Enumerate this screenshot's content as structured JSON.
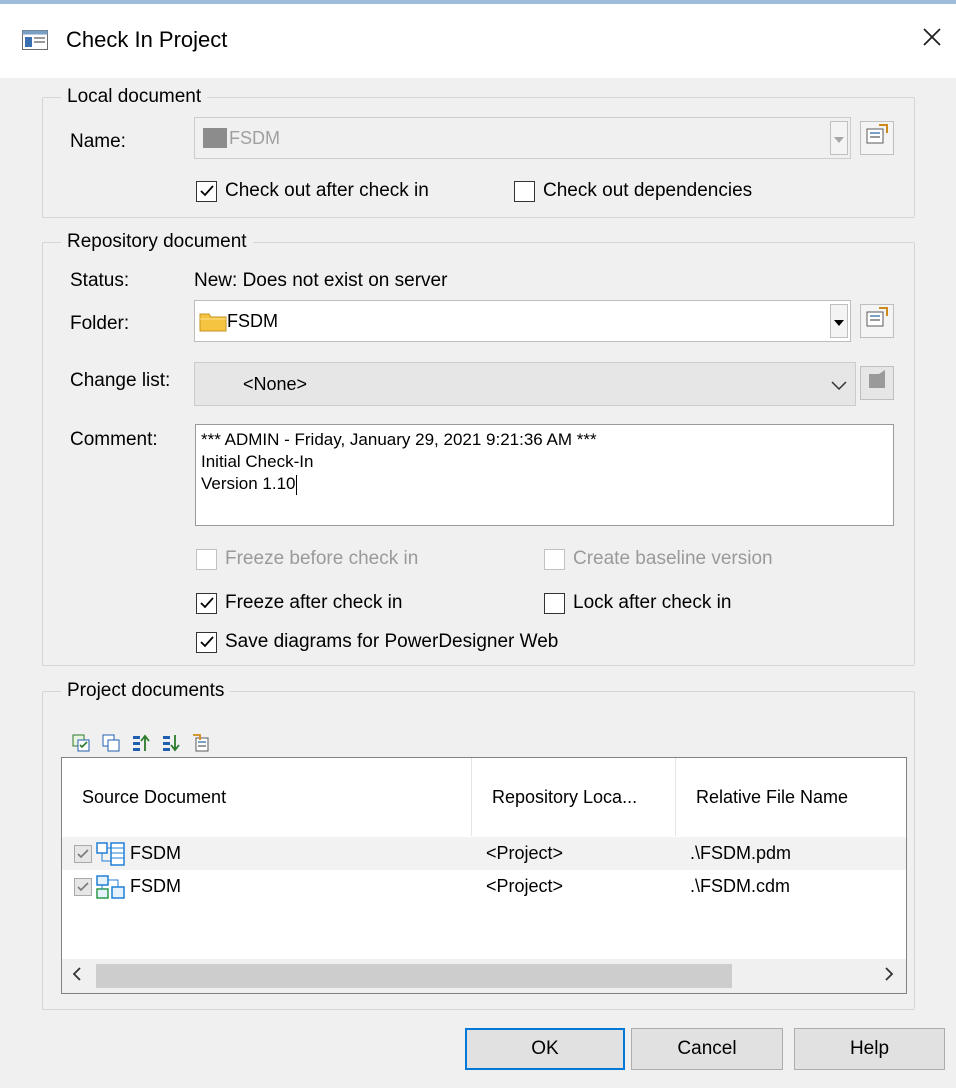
{
  "window": {
    "title": "Check In Project"
  },
  "local_document": {
    "legend": "Local document",
    "name_label": "Name:",
    "name_value": "FSDM",
    "check_out_after_label": "Check out after check in",
    "check_out_after_checked": true,
    "check_out_deps_label": "Check out dependencies",
    "check_out_deps_checked": false
  },
  "repository_document": {
    "legend": "Repository document",
    "status_label": "Status:",
    "status_value": "New: Does not exist on server",
    "folder_label": "Folder:",
    "folder_value": "FSDM",
    "change_list_label": "Change list:",
    "change_list_value": "<None>",
    "comment_label": "Comment:",
    "comment_lines": [
      "*** ADMIN - Friday, January 29, 2021 9:21:36 AM ***",
      "Initial Check-In",
      "Version 1.10"
    ],
    "freeze_before_label": "Freeze before check in",
    "create_baseline_label": "Create baseline version",
    "freeze_after_label": "Freeze after check in",
    "freeze_after_checked": true,
    "lock_after_label": "Lock after check in",
    "lock_after_checked": false,
    "save_diagrams_label": "Save diagrams for PowerDesigner Web",
    "save_diagrams_checked": true
  },
  "project_documents": {
    "legend": "Project documents",
    "toolbar_icons": [
      "select-all-icon",
      "deselect-all-icon",
      "move-up-icon",
      "move-down-icon",
      "properties-icon"
    ],
    "columns": [
      "Source Document",
      "Repository Loca...",
      "Relative File Name"
    ],
    "rows": [
      {
        "name": "FSDM",
        "icon": "physical-model-icon",
        "location": "<Project>",
        "file": ".\\FSDM.pdm",
        "checked": true
      },
      {
        "name": "FSDM",
        "icon": "conceptual-model-icon",
        "location": "<Project>",
        "file": ".\\FSDM.cdm",
        "checked": true
      }
    ]
  },
  "buttons": {
    "ok": "OK",
    "cancel": "Cancel",
    "help": "Help"
  },
  "colors": {
    "accent": "#0078d7",
    "folder": "#f5c542",
    "model_icon": "#1f7fd6"
  }
}
